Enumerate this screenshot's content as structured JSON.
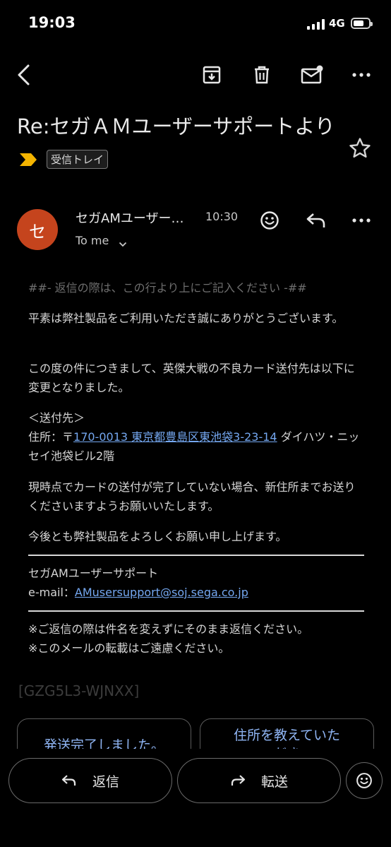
{
  "status": {
    "time": "19:03",
    "network": "4G"
  },
  "subject": "Re:セガＡＭユーザーサポートより",
  "label": "受信トレイ",
  "sender": {
    "initial": "セ",
    "name": "セガAMユーザー…",
    "time": "10:30",
    "to": "To me"
  },
  "body": {
    "separator_line": "##- 返信の際は、この行より上にご記入ください -##",
    "p1": "平素は弊社製品をご利用いただき誠にありがとうございます。",
    "p2": "この度の件につきまして、英傑大戦の不良カード送付先は以下に変更となりました。",
    "address_header": "＜送付先＞",
    "address_prefix": "住所：〒",
    "address_link": "170-0013 東京都豊島区東池袋3-23-14",
    "address_suffix": " ダイハツ・ニッセイ池袋ビル2階",
    "p3": "現時点でカードの送付が完了していない場合、新住所までお送りくださいますようお願いいたします。",
    "p4": "今後とも弊社製品をよろしくお願い申し上げます。",
    "signature_name": "セガAMユーザーサポート",
    "email_prefix": "e-mail：",
    "email": "AMusersupport@soj.sega.co.jp",
    "note1": "※ご返信の際は件名を変えずにそのまま返信ください。",
    "note2": "※このメールの転載はご遠慮ください。",
    "trace_code": "[GZG5L3-WJNXX]"
  },
  "smart_replies": [
    "発送完了しました。",
    "住所を教えていただき"
  ],
  "actions": {
    "reply": "返信",
    "forward": "転送"
  }
}
